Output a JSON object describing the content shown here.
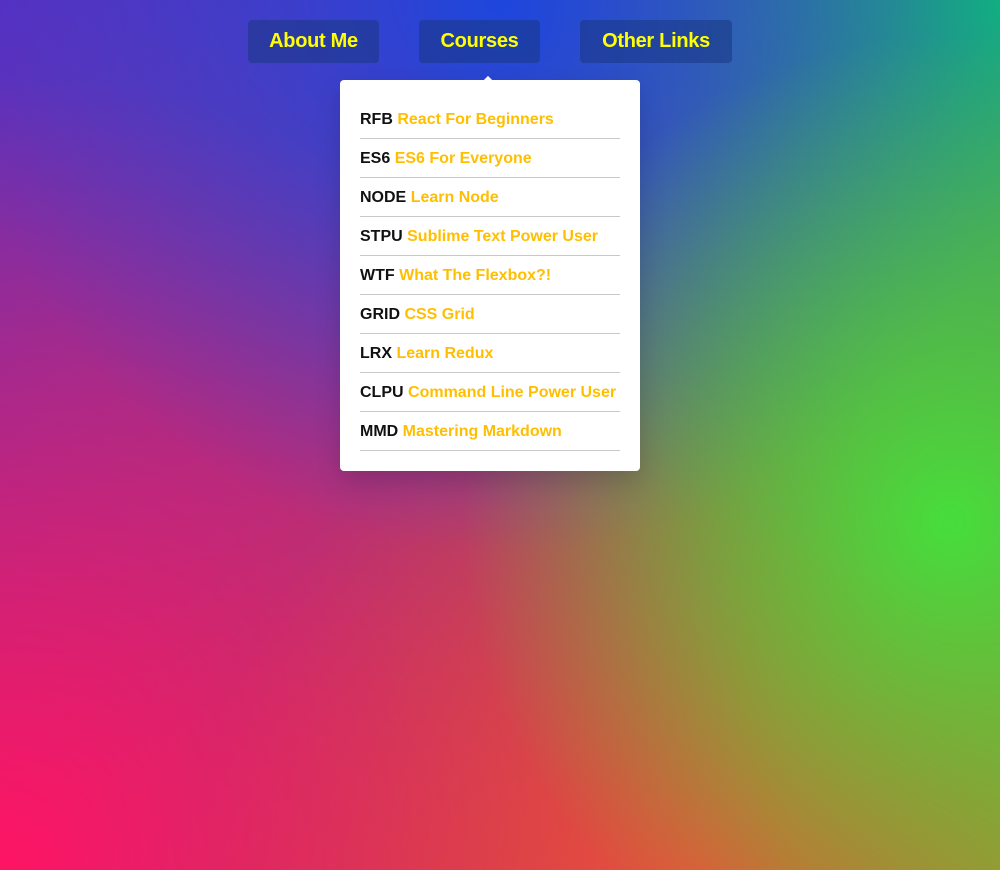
{
  "nav": {
    "items": [
      {
        "label": "About Me"
      },
      {
        "label": "Courses"
      },
      {
        "label": "Other Links"
      }
    ],
    "active_index": 1
  },
  "colors": {
    "menu_text": "#ffff00",
    "course_title": "#ffbf00",
    "course_code": "#111111",
    "dropdown_bg": "#ffffff"
  },
  "courses_dropdown": {
    "items": [
      {
        "code": "RFB",
        "title": "React For Beginners"
      },
      {
        "code": "ES6",
        "title": "ES6 For Everyone"
      },
      {
        "code": "NODE",
        "title": "Learn Node"
      },
      {
        "code": "STPU",
        "title": "Sublime Text Power User"
      },
      {
        "code": "WTF",
        "title": "What The Flexbox?!"
      },
      {
        "code": "GRID",
        "title": "CSS Grid"
      },
      {
        "code": "LRX",
        "title": "Learn Redux"
      },
      {
        "code": "CLPU",
        "title": "Command Line Power User"
      },
      {
        "code": "MMD",
        "title": "Mastering Markdown"
      }
    ]
  }
}
